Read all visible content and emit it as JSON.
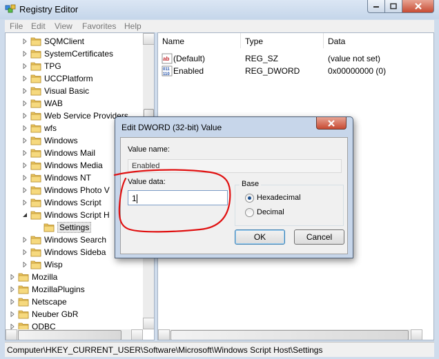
{
  "window": {
    "title": "Registry Editor",
    "app_icon": "regedit-icon"
  },
  "menu": [
    "File",
    "Edit",
    "View",
    "Favorites",
    "Help"
  ],
  "tree": {
    "items": [
      {
        "label": "SQMClient",
        "level": 2
      },
      {
        "label": "SystemCertificates",
        "level": 2
      },
      {
        "label": "TPG",
        "level": 2
      },
      {
        "label": "UCCPlatform",
        "level": 2
      },
      {
        "label": "Visual Basic",
        "level": 2
      },
      {
        "label": "WAB",
        "level": 2
      },
      {
        "label": "Web Service Providers",
        "level": 2
      },
      {
        "label": "wfs",
        "level": 2
      },
      {
        "label": "Windows",
        "level": 2
      },
      {
        "label": "Windows Mail",
        "level": 2
      },
      {
        "label": "Windows Media",
        "level": 2
      },
      {
        "label": "Windows NT",
        "level": 2
      },
      {
        "label": "Windows Photo V",
        "level": 2
      },
      {
        "label": "Windows Script",
        "level": 2
      },
      {
        "label": "Windows Script H",
        "level": 2,
        "expanded": true
      },
      {
        "label": "Settings",
        "level": 3,
        "selected": true
      },
      {
        "label": "Windows Search",
        "level": 2
      },
      {
        "label": "Windows Sideba",
        "level": 2
      },
      {
        "label": "Wisp",
        "level": 2
      },
      {
        "label": "Mozilla",
        "level": 1
      },
      {
        "label": "MozillaPlugins",
        "level": 1
      },
      {
        "label": "Netscape",
        "level": 1
      },
      {
        "label": "Neuber GbR",
        "level": 1
      },
      {
        "label": "ODBC",
        "level": 1
      }
    ]
  },
  "list": {
    "columns": [
      "Name",
      "Type",
      "Data"
    ],
    "rows": [
      {
        "name": "(Default)",
        "type": "REG_SZ",
        "data": "(value not set)",
        "icon": "string-value-icon"
      },
      {
        "name": "Enabled",
        "type": "REG_DWORD",
        "data": "0x00000000 (0)",
        "icon": "binary-value-icon"
      }
    ]
  },
  "status": {
    "path": "Computer\\HKEY_CURRENT_USER\\Software\\Microsoft\\Windows Script Host\\Settings"
  },
  "dialog": {
    "title": "Edit DWORD (32-bit) Value",
    "value_name_label": "Value name:",
    "value_name": "Enabled",
    "value_data_label": "Value data:",
    "value_data": "1",
    "base_label": "Base",
    "base_options": [
      {
        "label": "Hexadecimal",
        "checked": true
      },
      {
        "label": "Decimal",
        "checked": false
      }
    ],
    "ok_label": "OK",
    "cancel_label": "Cancel"
  },
  "annotation_color": "#e01010"
}
